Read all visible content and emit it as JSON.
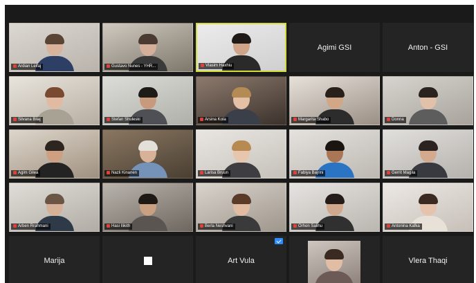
{
  "meeting": {
    "participants": [
      {
        "name": "Ardian Leifaj",
        "type": "video",
        "bg": [
          "#dcd8d2",
          "#b9b3ab"
        ],
        "skin": "#d9b39b",
        "hair": "#5a4434",
        "shirt": "#2e3f66"
      },
      {
        "name": "Gustavo Nunes - YHR...",
        "type": "video",
        "bg": [
          "#cfc9bf",
          "#7e776c"
        ],
        "skin": "#d4b09a",
        "hair": "#4a3a30",
        "shirt": "#3a3a3a"
      },
      {
        "name": "Vlasim Haxhiu",
        "type": "video",
        "speaking": true,
        "bg": [
          "#ececec",
          "#cfcfcf"
        ],
        "skin": "#cfa488",
        "hair": "#1f1a17",
        "shirt": "#2a2a2a"
      },
      {
        "name": "Agimi GSI",
        "type": "name"
      },
      {
        "name": "Anton - GSI",
        "type": "name"
      },
      {
        "name": "Silvana Bilaj",
        "type": "video",
        "bg": [
          "#e8e4dc",
          "#b7aea2"
        ],
        "skin": "#e0bba2",
        "hair": "#7a4a30",
        "shirt": "#a8a295"
      },
      {
        "name": "Stefan Shuleski",
        "type": "video",
        "bg": [
          "#dcdcd8",
          "#b0b0aa"
        ],
        "skin": "#c79a7d",
        "hair": "#1d1a18",
        "shirt": "#4e5055"
      },
      {
        "name": "Arsina Kola",
        "type": "video",
        "bg": [
          "#8d7a6d",
          "#3b322c"
        ],
        "skin": "#e3c0a6",
        "hair": "#b48a55",
        "shirt": "#3b3f4a"
      },
      {
        "name": "Margarita Shabo",
        "type": "video",
        "bg": [
          "#e6e1da",
          "#9b8f85"
        ],
        "skin": "#d2a788",
        "hair": "#2a201b",
        "shirt": "#2c2c2c"
      },
      {
        "name": "Donna",
        "type": "video",
        "bg": [
          "#d7d4cf",
          "#a8a39c"
        ],
        "skin": "#e2c1aa",
        "hair": "#2b2320",
        "shirt": "#5d5d5d"
      },
      {
        "name": "Agim Gilea",
        "type": "video",
        "bg": [
          "#ddd6cc",
          "#a0917f"
        ],
        "skin": "#cf9f82",
        "hair": "#2e2520",
        "shirt": "#232323"
      },
      {
        "name": "Nazli Kinanen",
        "type": "video",
        "bg": [
          "#8a7761",
          "#4a3f33"
        ],
        "skin": "#d8b199",
        "hair": "#e3e0da",
        "shirt": "#7592b8"
      },
      {
        "name": "Larisa Bruun",
        "type": "video",
        "bg": [
          "#e9e6e2",
          "#c6c1ba"
        ],
        "skin": "#e6c6ad",
        "hair": "#b78a52",
        "shirt": "#3d3d42"
      },
      {
        "name": "Fabiya Bajrini",
        "type": "video",
        "bg": [
          "#e4e2de",
          "#bdb8b2"
        ],
        "skin": "#a97656",
        "hair": "#1b1512",
        "shirt": "#2b74c4"
      },
      {
        "name": "Gerrit Magila",
        "type": "video",
        "bg": [
          "#e1dfdc",
          "#b5b2ad"
        ],
        "skin": "#d4aa8f",
        "hair": "#2a2320",
        "shirt": "#383a40"
      },
      {
        "name": "Arben Rrahmani",
        "type": "video",
        "bg": [
          "#e0ddd8",
          "#b1aca5"
        ],
        "skin": "#d6b097",
        "hair": "#6b5544",
        "shirt": "#2f3a48"
      },
      {
        "name": "Hasi Ilikith",
        "type": "video",
        "bg": [
          "#b9b4ad",
          "#6e675f"
        ],
        "skin": "#c9a081",
        "hair": "#1e1915",
        "shirt": "#5a5550"
      },
      {
        "name": "Berla Neshvani",
        "type": "video",
        "bg": [
          "#d8d3cc",
          "#9f968c"
        ],
        "skin": "#e1bca3",
        "hair": "#5a3b28",
        "shirt": "#3a3a3a"
      },
      {
        "name": "Orhon Salihu",
        "type": "video",
        "bg": [
          "#e5e3e0",
          "#bab6b0"
        ],
        "skin": "#d0a88e",
        "hair": "#231c18",
        "shirt": "#303030"
      },
      {
        "name": "Antonina Kafka",
        "type": "video",
        "bg": [
          "#ece8e4",
          "#c7c0b9"
        ],
        "skin": "#e6c3ac",
        "hair": "#3a2a22",
        "shirt": "#e8e1d8"
      },
      {
        "name": "Marija",
        "type": "name"
      },
      {
        "name": "",
        "type": "blank"
      },
      {
        "name": "Art Vula",
        "type": "name",
        "badge": true
      },
      {
        "name": "",
        "type": "inset",
        "bg": [
          "#cfc6c0",
          "#8b7f79"
        ],
        "skin": "#e2bda5",
        "hair": "#3b2a22",
        "shirt": "#6b5a55"
      },
      {
        "name": "Vlera Thaqi",
        "type": "name"
      }
    ]
  }
}
